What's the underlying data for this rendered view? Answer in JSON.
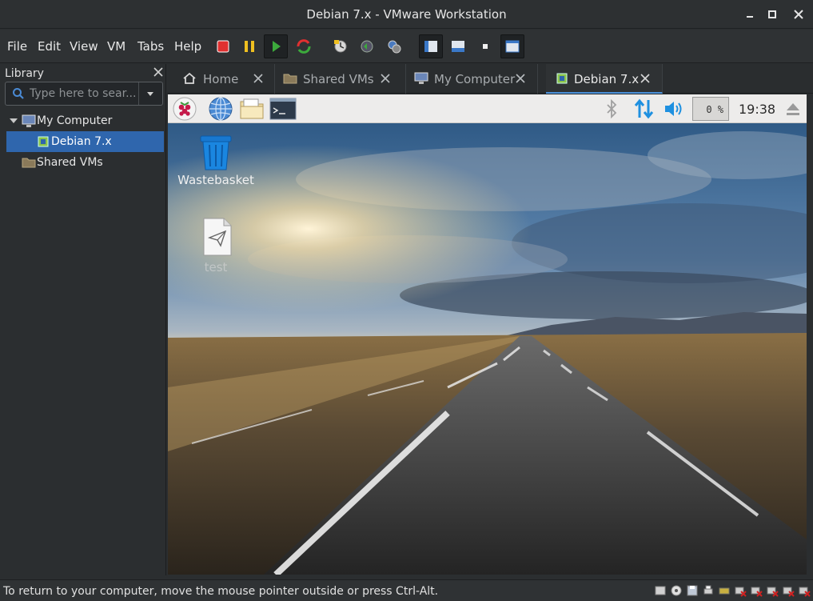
{
  "window": {
    "title": "Debian 7.x - VMware Workstation"
  },
  "menu": [
    "File",
    "Edit",
    "View",
    "VM",
    "Tabs",
    "Help"
  ],
  "library": {
    "header": "Library",
    "search_placeholder": "Type here to sear...",
    "tree": [
      {
        "label": "My Computer",
        "expanded": true
      },
      {
        "label": "Debian 7.x",
        "selected": true
      },
      {
        "label": "Shared VMs"
      }
    ]
  },
  "tabs": [
    {
      "label": "Home",
      "icon": "home-icon"
    },
    {
      "label": "Shared VMs",
      "icon": "folder-icon"
    },
    {
      "label": "My Computer",
      "icon": "computer-icon"
    },
    {
      "label": "Debian 7.x",
      "icon": "vm-icon",
      "active": true
    }
  ],
  "guest": {
    "panel": {
      "cpu": "0 %",
      "clock": "19:38"
    },
    "desktop_icons": [
      {
        "label": "Wastebasket",
        "icon": "trash-icon"
      },
      {
        "label": "test",
        "icon": "document-icon"
      }
    ]
  },
  "status": {
    "message": "To return to your computer, move the mouse pointer outside or press Ctrl-Alt."
  },
  "colors": {
    "accent": "#2f66ad",
    "tab_underline": "#4a90d9",
    "panel_arrows": "#1e90e0"
  }
}
